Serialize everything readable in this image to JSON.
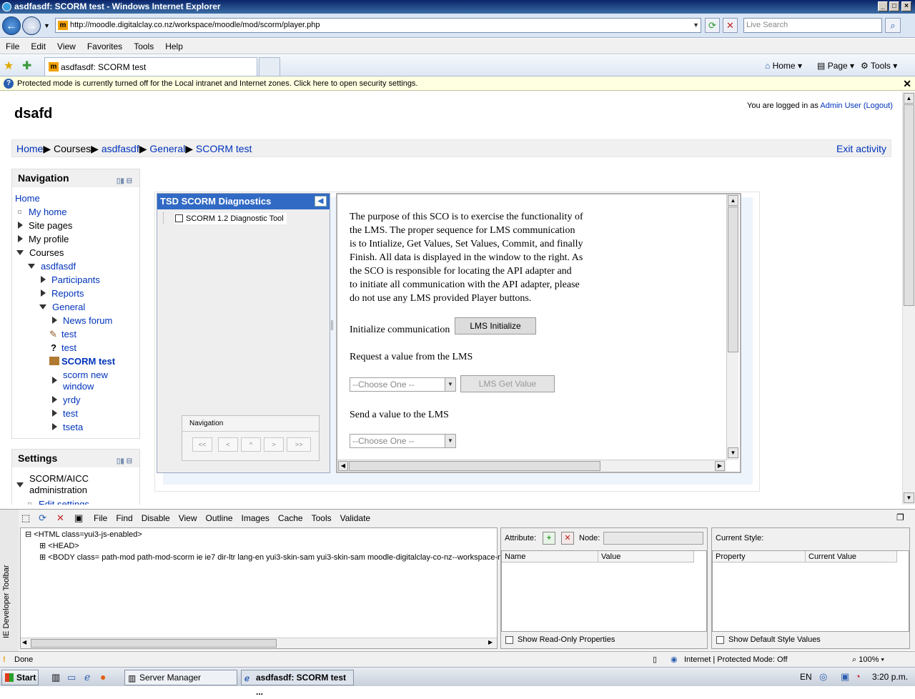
{
  "window": {
    "title": "asdfasdf: SCORM test - Windows Internet Explorer"
  },
  "browser": {
    "url": "http://moodle.digitalclay.co.nz/workspace/moodle/mod/scorm/player.php",
    "search_placeholder": "Live Search",
    "menu": [
      "File",
      "Edit",
      "View",
      "Favorites",
      "Tools",
      "Help"
    ],
    "tab_title": "asdfasdf: SCORM test",
    "commands": {
      "home": "Home",
      "page": "Page",
      "tools": "Tools"
    },
    "infobar": "Protected mode is currently turned off for the Local intranet and Internet zones.  Click here to open security settings."
  },
  "page": {
    "site_name": "dsafd",
    "login_prefix": "You are logged in as",
    "login_user": "Admin User",
    "logout": "(Logout)",
    "breadcrumb": [
      "Home",
      "Courses",
      "asdfasdf",
      "General",
      "SCORM test"
    ],
    "exit_activity": "Exit activity",
    "navigation": {
      "title": "Navigation",
      "items": [
        "Home",
        "My home",
        "Site pages",
        "My profile",
        "Courses",
        "asdfasdf",
        "Participants",
        "Reports",
        "General",
        "News forum",
        "test",
        "test",
        "SCORM test",
        "scorm new",
        "window",
        "yrdy",
        "test",
        "tseta"
      ]
    },
    "settings": {
      "title": "Settings",
      "items": [
        "SCORM/AICC",
        "administration",
        "Edit settings"
      ]
    }
  },
  "scorm": {
    "toc_title": "TSD SCORM Diagnostics",
    "toc_item": "SCORM 1.2 Diagnostic Tool",
    "nav_title": "Navigation",
    "nav_buttons": [
      "<<",
      "<",
      "^",
      ">",
      ">>"
    ],
    "sco": {
      "intro": [
        "The purpose of this SCO is to exercise the functionality of",
        "the LMS. The proper sequence for LMS communication",
        "is to Intialize, Get Values, Set Values, Commit, and finally",
        "Finish. All data is displayed in the window to the right.  As",
        "the SCO is responsible for locating the API adapter and",
        "to initiate all communication with the API adapter, please",
        "do not use any LMS provided Player buttons."
      ],
      "init_label": "Initialize communication",
      "init_button": "LMS Initialize",
      "get_label": "Request a value from the LMS",
      "choose": "--Choose One --",
      "get_button": "LMS Get Value",
      "set_label": "Send a value to the LMS"
    }
  },
  "devtools": {
    "menu": [
      "File",
      "Find",
      "Disable",
      "View",
      "Outline",
      "Images",
      "Cache",
      "Tools",
      "Validate"
    ],
    "side_label": "IE Developer Toolbar",
    "dom": [
      "<HTML class=yui3-js-enabled>",
      "<HEAD>",
      "<BODY class= path-mod path-mod-scorm ie ie7 dir-ltr lang-en yui3-skin-sam yui3-skin-sam moodle-digitalclay-co-nz--workspace-moo"
    ],
    "attribute_label": "Attribute:",
    "node_label": "Node:",
    "attr_cols": [
      "Name",
      "Value"
    ],
    "readonly": "Show Read-Only Properties",
    "style_label": "Current Style:",
    "style_cols": [
      "Property",
      "Current Value"
    ],
    "default_style": "Show Default Style Values"
  },
  "statusbar": {
    "text": "Done",
    "zone": "Internet | Protected Mode: Off",
    "zoom": "100%"
  },
  "taskbar": {
    "start": "Start",
    "tasks": [
      "Server Manager",
      "asdfasdf: SCORM test ..."
    ],
    "lang": "EN",
    "time": "3:20 p.m."
  }
}
